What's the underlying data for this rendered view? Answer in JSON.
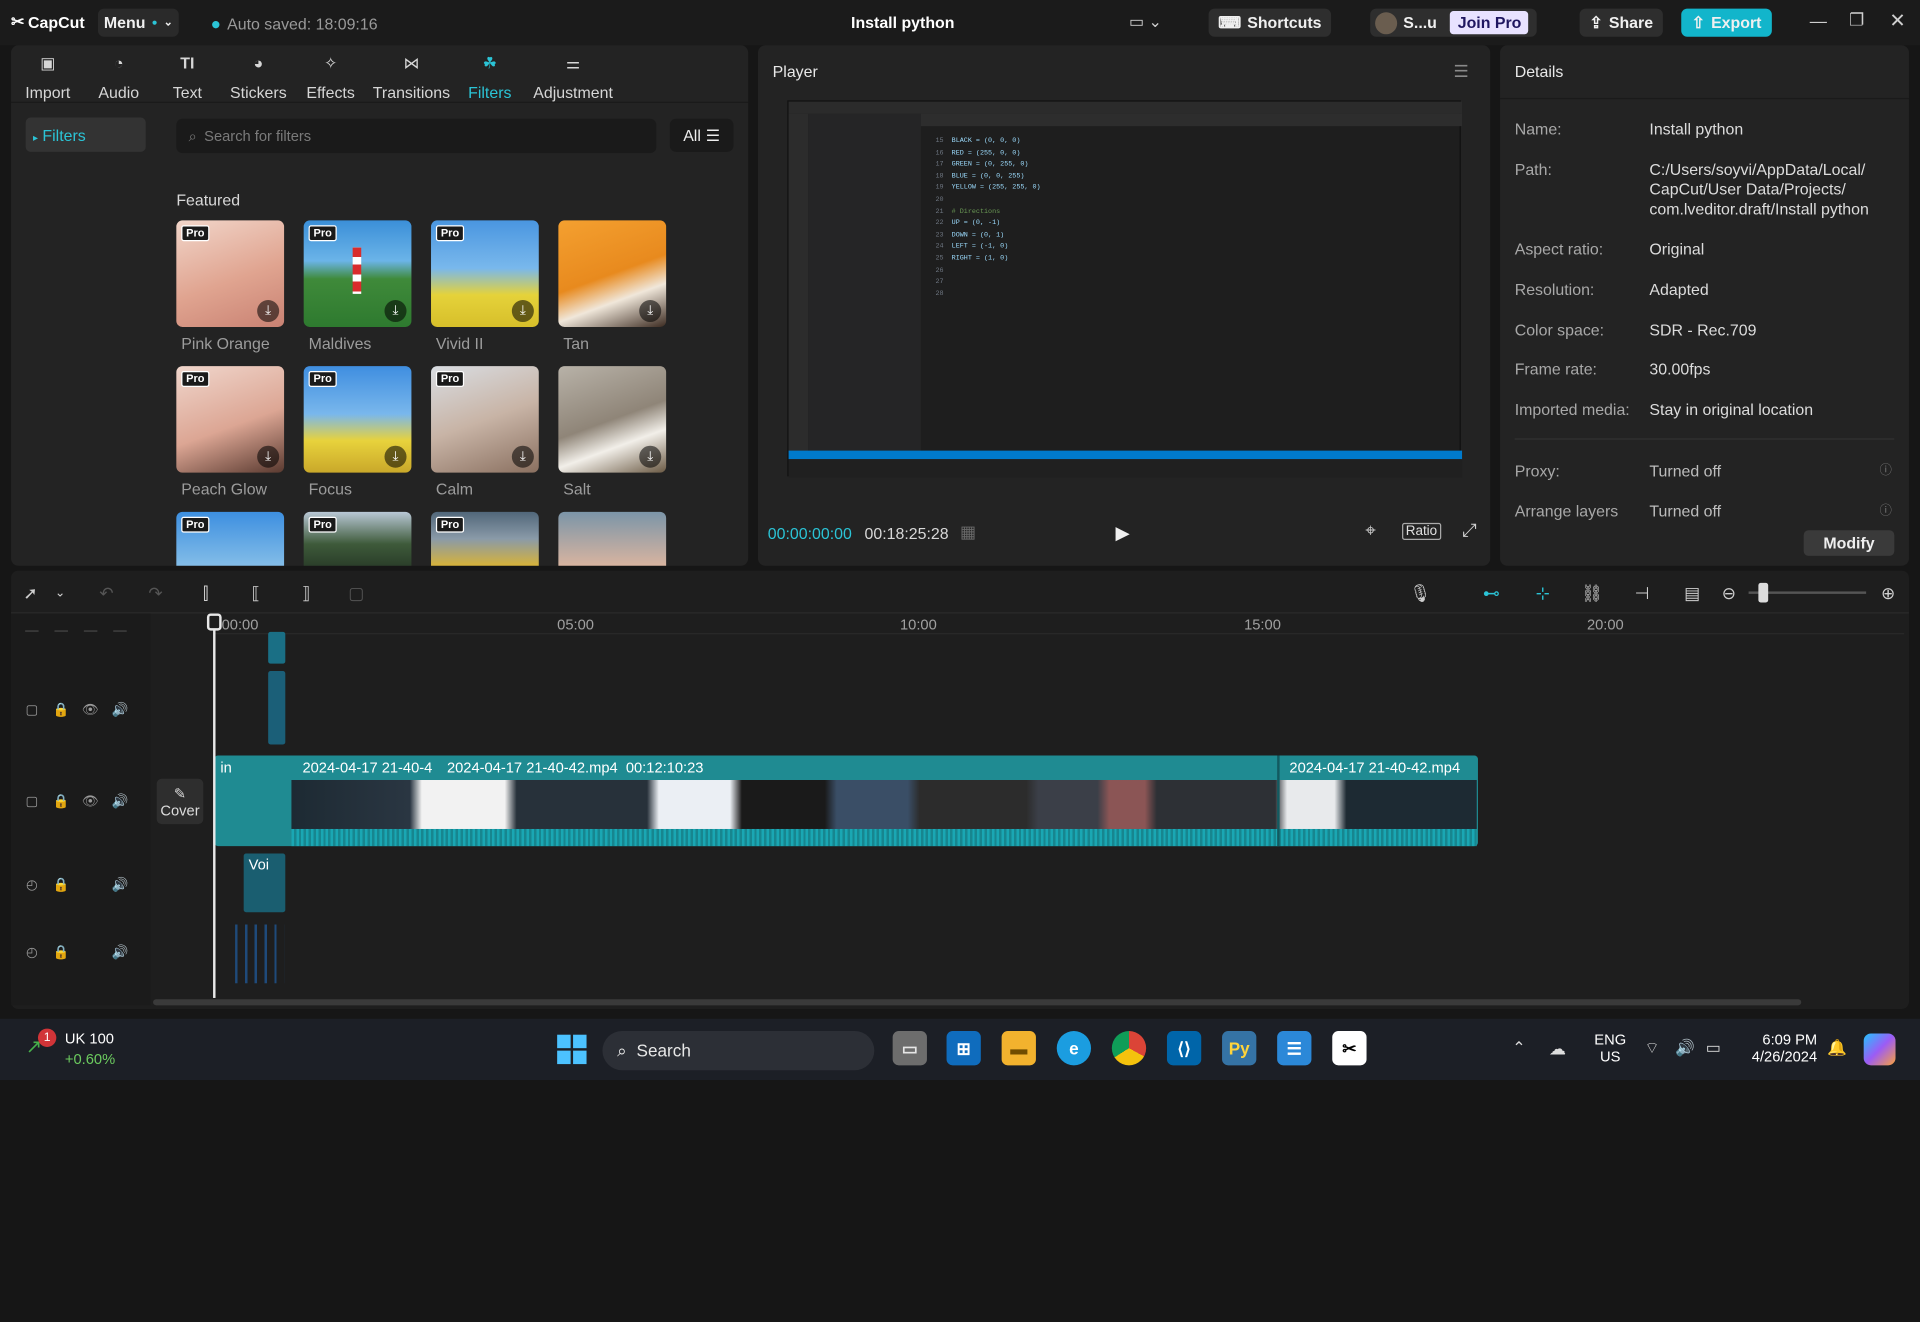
{
  "app": {
    "logo": "CapCut",
    "menu_label": "Menu",
    "autosave": "Auto saved: 18:09:16",
    "project_title": "Install python",
    "shortcuts": "Shortcuts",
    "user": "S...u",
    "join_pro": "Join Pro",
    "share": "Share",
    "export": "Export"
  },
  "media_tabs": [
    {
      "label": "Import",
      "icon": "import-icon"
    },
    {
      "label": "Audio",
      "icon": "audio-icon"
    },
    {
      "label": "Text",
      "icon": "text-icon"
    },
    {
      "label": "Stickers",
      "icon": "stickers-icon"
    },
    {
      "label": "Effects",
      "icon": "effects-icon"
    },
    {
      "label": "Transitions",
      "icon": "transitions-icon"
    },
    {
      "label": "Filters",
      "icon": "filters-icon",
      "active": true
    },
    {
      "label": "Adjustment",
      "icon": "adjustment-icon"
    }
  ],
  "filters": {
    "side_item": "Filters",
    "search_placeholder": "Search for filters",
    "all_label": "All",
    "section_title": "Featured",
    "items": [
      {
        "name": "Pink Orange",
        "pro": "Pro"
      },
      {
        "name": "Maldives",
        "pro": "Pro"
      },
      {
        "name": "Vivid II",
        "pro": "Pro"
      },
      {
        "name": "Tan",
        "pro": ""
      },
      {
        "name": "Peach Glow",
        "pro": "Pro"
      },
      {
        "name": "Focus",
        "pro": "Pro"
      },
      {
        "name": "Calm",
        "pro": "Pro"
      },
      {
        "name": "Salt",
        "pro": ""
      }
    ],
    "row3_pro": [
      "Pro",
      "Pro",
      "Pro",
      ""
    ]
  },
  "player": {
    "title": "Player",
    "current_time": "00:00:00:00",
    "total_time": "00:18:25:28",
    "ratio": "Ratio",
    "code_lines": [
      {
        "n": "15",
        "t": "BLACK = (0, 0, 0)"
      },
      {
        "n": "16",
        "t": "RED = (255, 0, 0)"
      },
      {
        "n": "17",
        "t": "GREEN = (0, 255, 0)"
      },
      {
        "n": "18",
        "t": "BLUE = (0, 0, 255)"
      },
      {
        "n": "19",
        "t": "YELLOW = (255, 255, 0)"
      },
      {
        "n": "20",
        "t": ""
      },
      {
        "n": "21",
        "t": "# Directions"
      },
      {
        "n": "22",
        "t": "UP = (0, -1)"
      },
      {
        "n": "23",
        "t": "DOWN = (0, 1)"
      },
      {
        "n": "24",
        "t": "LEFT = (-1, 0)"
      },
      {
        "n": "25",
        "t": "RIGHT = (1, 0)"
      },
      {
        "n": "26",
        "t": ""
      },
      {
        "n": "27",
        "t": ""
      },
      {
        "n": "28",
        "t": ""
      }
    ]
  },
  "details": {
    "title": "Details",
    "rows": [
      {
        "label": "Name:",
        "value": "Install python"
      },
      {
        "label": "Path:",
        "value": "C:/Users/soyvi/AppData/Local/\nCapCut/User Data/Projects/\ncom.lveditor.draft/Install python"
      },
      {
        "label": "Aspect ratio:",
        "value": "Original"
      },
      {
        "label": "Resolution:",
        "value": "Adapted"
      },
      {
        "label": "Color space:",
        "value": "SDR - Rec.709"
      },
      {
        "label": "Frame rate:",
        "value": "30.00fps"
      },
      {
        "label": "Imported media:",
        "value": "Stay in original location"
      }
    ],
    "rows2": [
      {
        "label": "Proxy:",
        "value": "Turned off"
      },
      {
        "label": "Arrange layers",
        "value": "Turned off"
      }
    ],
    "modify": "Modify"
  },
  "timeline": {
    "ruler": [
      "00:00",
      "05:00",
      "10:00",
      "15:00",
      "20:00"
    ],
    "cover": "Cover",
    "clip_in": "in",
    "clip_a": "2024-04-17 21-40-4",
    "clip_b": "2024-04-17 21-40-42.mp4  00:12:10:23",
    "clip_c": "2024-04-17 21-40-42.mp4",
    "voice_clip": "Voi"
  },
  "taskbar": {
    "stock_name": "UK 100",
    "stock_change": "+0.60%",
    "stock_badge": "1",
    "search": "Search",
    "lang1": "ENG",
    "lang2": "US",
    "time": "6:09 PM",
    "date": "4/26/2024"
  },
  "colors": {
    "accent": "#2bc4d6",
    "export": "#12b5cb",
    "clip": "#1f8b92"
  }
}
